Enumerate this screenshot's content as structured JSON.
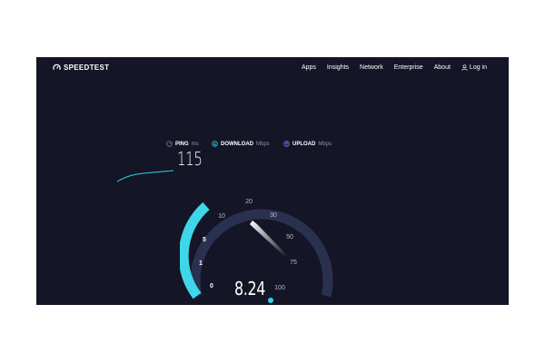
{
  "brand": {
    "name": "SPEEDTEST"
  },
  "nav": {
    "items": [
      "Apps",
      "Insights",
      "Network",
      "Enterprise",
      "About"
    ],
    "login": "Log in"
  },
  "stats": {
    "ping": {
      "label": "PING",
      "unit": "ms",
      "value": "115",
      "icon": "ping-gauge-icon"
    },
    "download": {
      "label": "DOWNLOAD",
      "unit": "Mbps",
      "icon": "download-arrow-icon",
      "color": "#2fd4e8"
    },
    "upload": {
      "label": "UPLOAD",
      "unit": "Mbps",
      "icon": "upload-arrow-icon",
      "color": "#a86bf0"
    }
  },
  "gauge": {
    "ticks": [
      "0",
      "1",
      "5",
      "10",
      "20",
      "30",
      "50",
      "75",
      "100"
    ],
    "current_speed": "8.24",
    "progress_color": "#3fd6ea",
    "track_color": "#2a3150"
  },
  "colors": {
    "background": "#141526",
    "accent": "#2fd4e8"
  }
}
